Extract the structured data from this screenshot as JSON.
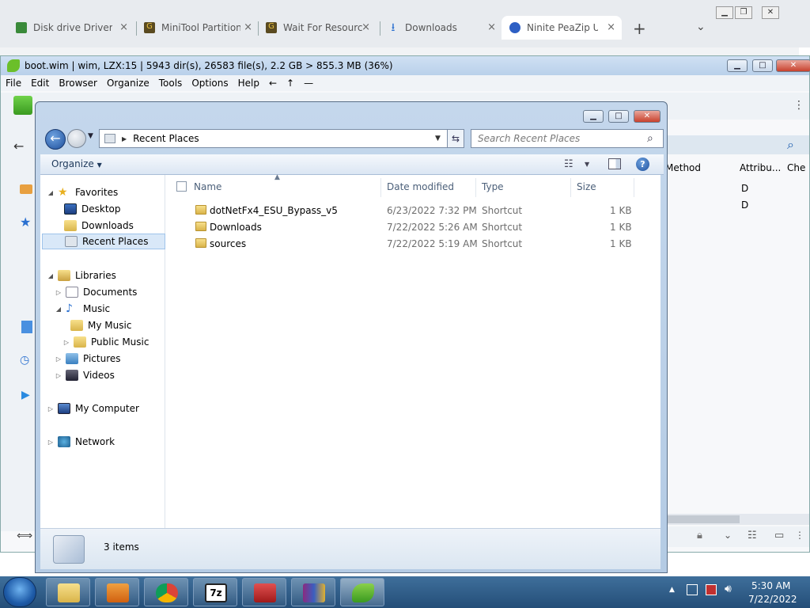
{
  "browser": {
    "tabs": [
      {
        "label": "Disk drive Driver",
        "icon": "driver-icon",
        "color": "#3a8a3a"
      },
      {
        "label": "MiniTool Partition",
        "icon": "minitool-icon",
        "color": "#5a4a20"
      },
      {
        "label": "Wait For Resourc",
        "icon": "minitool-icon",
        "color": "#5a4a20"
      },
      {
        "label": "Downloads",
        "icon": "download-icon",
        "color": "#2a6fd0"
      },
      {
        "label": "Ninite PeaZip Ur",
        "icon": "ninite-icon",
        "color": "#2d5fc4"
      }
    ],
    "close_glyph": "×",
    "new_tab_glyph": "+",
    "tab_list_glyph": "⌄"
  },
  "peazip": {
    "title": "boot.wim | wim, LZX:15 | 5943 dir(s), 26583 file(s), 2.2 GB > 855.3 MB (36%)",
    "menu": [
      "File",
      "Edit",
      "Browser",
      "Organize",
      "Tools",
      "Options",
      "Help",
      "←",
      "↑",
      "—"
    ],
    "columns": [
      "Method",
      "Attribu...",
      "Che"
    ],
    "attr_values": [
      "D",
      "D"
    ]
  },
  "explorer": {
    "breadcrumb": "Recent Places",
    "search_placeholder": "Search Recent Places",
    "organize": "Organize",
    "nav": {
      "favorites": "Favorites",
      "desktop": "Desktop",
      "downloads": "Downloads",
      "recent": "Recent Places",
      "libraries": "Libraries",
      "documents": "Documents",
      "music": "Music",
      "my_music": "My Music",
      "public_music": "Public Music",
      "pictures": "Pictures",
      "videos": "Videos",
      "computer": "My Computer",
      "network": "Network"
    },
    "headers": {
      "name": "Name",
      "date": "Date modified",
      "type": "Type",
      "size": "Size"
    },
    "files": [
      {
        "name": "dotNetFx4_ESU_Bypass_v5",
        "date": "6/23/2022 7:32 PM",
        "type": "Shortcut",
        "size": "1 KB"
      },
      {
        "name": "Downloads",
        "date": "7/22/2022 5:26 AM",
        "type": "Shortcut",
        "size": "1 KB"
      },
      {
        "name": "sources",
        "date": "7/22/2022 5:19 AM",
        "type": "Shortcut",
        "size": "1 KB"
      }
    ],
    "status": "3 items"
  },
  "taskbar": {
    "time": "5:30 AM",
    "date": "7/22/2022"
  }
}
